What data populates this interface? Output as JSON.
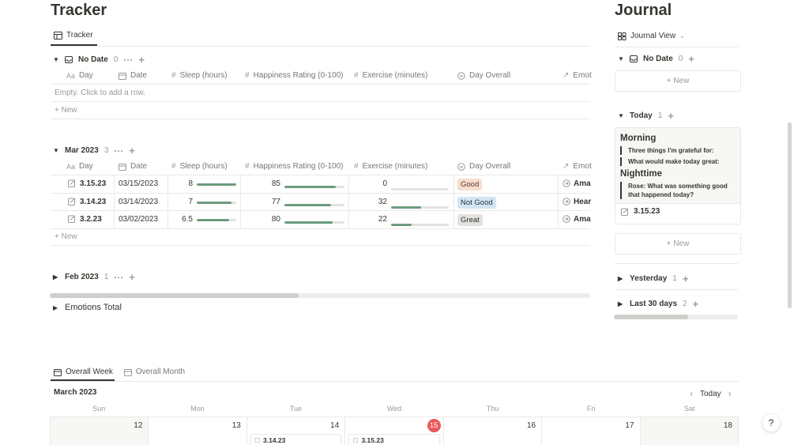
{
  "tracker": {
    "title": "Tracker",
    "tab_label": "Tracker",
    "no_date_group": {
      "label": "No Date",
      "count": "0"
    },
    "columns": [
      "Day",
      "Date",
      "Sleep (hours)",
      "Happiness Rating (0-100)",
      "Exercise (minutes)",
      "Day Overall",
      "Emot"
    ],
    "empty_text": "Empty. Click to add a row.",
    "new_label": "New",
    "mar_group": {
      "label": "Mar 2023",
      "count": "3"
    },
    "rows": [
      {
        "day": "3.15.23",
        "date": "03/15/2023",
        "sleep": "8",
        "sleep_pct": 100,
        "happiness": "85",
        "happiness_pct": 85,
        "exercise": "0",
        "exercise_pct": 0,
        "overall": "Good",
        "overall_style": "good",
        "emotion": "Ama"
      },
      {
        "day": "3.14.23",
        "date": "03/14/2023",
        "sleep": "7",
        "sleep_pct": 87,
        "happiness": "77",
        "happiness_pct": 77,
        "exercise": "32",
        "exercise_pct": 52,
        "overall": "Not Good",
        "overall_style": "notgood",
        "emotion": "Hear"
      },
      {
        "day": "3.2.23",
        "date": "03/02/2023",
        "sleep": "6.5",
        "sleep_pct": 81,
        "happiness": "80",
        "happiness_pct": 80,
        "exercise": "22",
        "exercise_pct": 36,
        "overall": "Great",
        "overall_style": "great",
        "emotion": "Ama"
      }
    ],
    "feb_group": {
      "label": "Feb 2023",
      "count": "1"
    },
    "emotions_total": "Emotions Total",
    "horizontal_scroll": 0.46
  },
  "journal": {
    "title": "Journal",
    "view_label": "Journal View",
    "no_date_group": {
      "label": "No Date",
      "count": "0"
    },
    "new_label": "New",
    "today_group": {
      "label": "Today",
      "count": "1"
    },
    "card": {
      "morning_heading": "Morning",
      "morning_q1": "Three things I'm grateful for:",
      "morning_q2": "What would make today great:",
      "night_heading": "Nighttime",
      "night_q1": "Rose: What was something good that happened today?",
      "page_title": "3.15.23"
    },
    "yesterday_group": {
      "label": "Yesterday",
      "count": "1"
    },
    "last30_group": {
      "label": "Last 30 days",
      "count": "2"
    },
    "horizontal_scroll": 0.6
  },
  "calendar": {
    "tabs": [
      "Overall Week",
      "Overall Month"
    ],
    "month_label": "March 2023",
    "today_label": "Today",
    "weekdays": [
      "Sun",
      "Mon",
      "Tue",
      "Wed",
      "Thu",
      "Fri",
      "Sat"
    ],
    "days": [
      "12",
      "13",
      "14",
      "15",
      "16",
      "17",
      "18"
    ],
    "today_index": 3,
    "events": {
      "tue": "3.14.23",
      "wed": "3.15.23"
    }
  },
  "help_label": "?",
  "colors": {
    "accent_bar": "#6c9b7d",
    "today_badge": "#eb5757"
  }
}
